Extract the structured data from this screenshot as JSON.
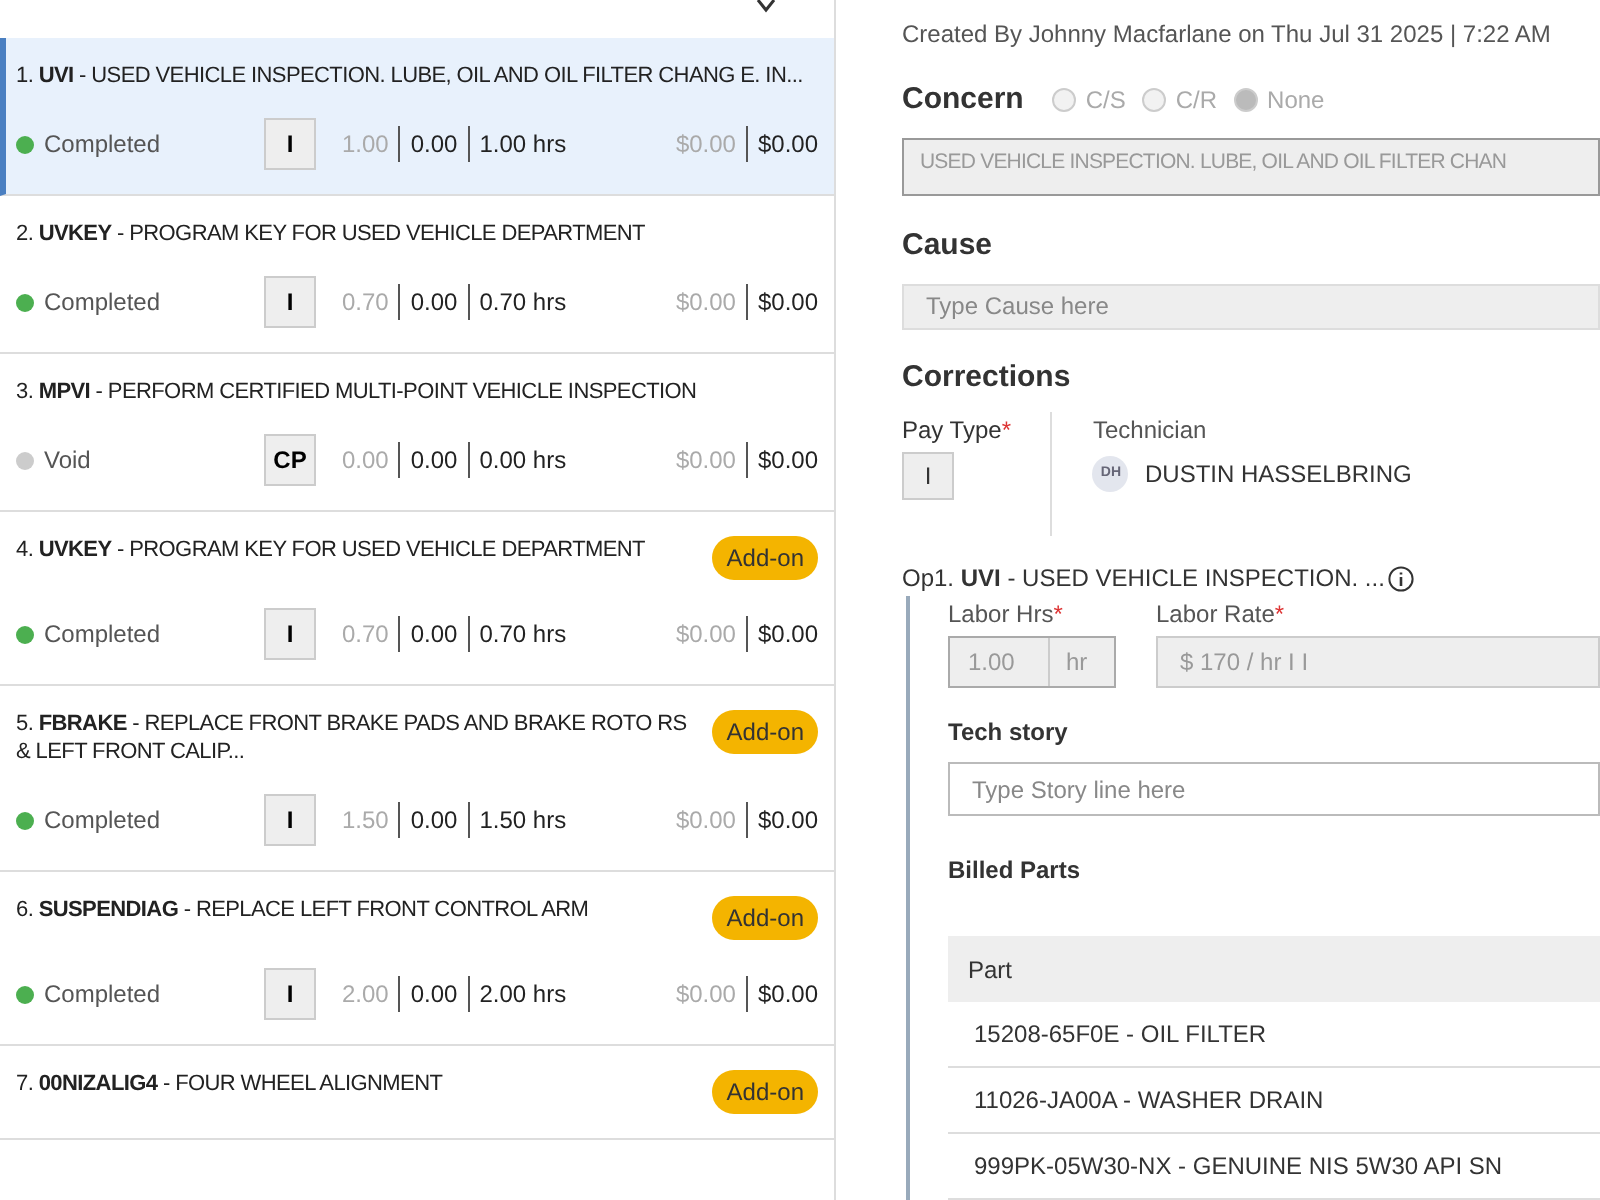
{
  "jobs": [
    {
      "title": "1. **UVI** - USED VEHICLE INSPECTION. LUBE, OIL AND OIL FILTER CHANG E. IN...",
      "selected": true,
      "status": {
        "label": "Completed",
        "color": "#4caf50"
      },
      "pay_type": "I",
      "hours": [
        "1.00",
        "0.00",
        "1.00 hrs"
      ],
      "amounts": [
        "$0.00",
        "$0.00"
      ]
    },
    {
      "title": "2. **UVKEY** - PROGRAM KEY FOR USED VEHICLE DEPARTMENT",
      "selected": false,
      "status": {
        "label": "Completed",
        "color": "#4caf50"
      },
      "pay_type": "I",
      "hours": [
        "0.70",
        "0.00",
        "0.70 hrs"
      ],
      "amounts": [
        "$0.00",
        "$0.00"
      ]
    },
    {
      "title": "3. **MPVI** - PERFORM CERTIFIED MULTI-POINT VEHICLE INSPECTION",
      "selected": false,
      "status": {
        "label": "Void",
        "color": "#cccccc"
      },
      "pay_type": "CP",
      "hours": [
        "0.00",
        "0.00",
        "0.00 hrs"
      ],
      "amounts": [
        "$0.00",
        "$0.00"
      ]
    },
    {
      "title": "4. **UVKEY** - PROGRAM KEY FOR USED VEHICLE DEPARTMENT",
      "badge": "Add-on",
      "selected": false,
      "status": {
        "label": "Completed",
        "color": "#4caf50"
      },
      "pay_type": "I",
      "hours": [
        "0.70",
        "0.00",
        "0.70 hrs"
      ],
      "amounts": [
        "$0.00",
        "$0.00"
      ]
    },
    {
      "title": "5. **FBRAKE** - REPLACE FRONT BRAKE PADS AND BRAKE ROTO RS & LEFT FRONT CALIP...",
      "badge": "Add-on",
      "selected": false,
      "status": {
        "label": "Completed",
        "color": "#4caf50"
      },
      "pay_type": "I",
      "hours": [
        "1.50",
        "0.00",
        "1.50 hrs"
      ],
      "amounts": [
        "$0.00",
        "$0.00"
      ]
    },
    {
      "title": "6. **SUSPENDIAG** - REPLACE LEFT FRONT CONTROL ARM",
      "badge": "Add-on",
      "selected": false,
      "status": {
        "label": "Completed",
        "color": "#4caf50"
      },
      "pay_type": "I",
      "hours": [
        "2.00",
        "0.00",
        "2.00 hrs"
      ],
      "amounts": [
        "$0.00",
        "$0.00"
      ]
    },
    {
      "title": "7. **00NIZALIG4** - FOUR WHEEL ALIGNMENT",
      "badge": "Add-on",
      "selected": false
    }
  ],
  "detail": {
    "created": "Created By Johnny Macfarlane on Thu Jul 31 2025 | 7:22 AM",
    "concern": {
      "heading": "Concern",
      "options": [
        {
          "label": "C/S",
          "selected": false
        },
        {
          "label": "C/R",
          "selected": false
        },
        {
          "label": "None",
          "selected": true
        }
      ],
      "value": "USED VEHICLE INSPECTION. LUBE, OIL AND OIL FILTER CHAN"
    },
    "cause": {
      "heading": "Cause",
      "placeholder": "Type Cause here"
    },
    "corrections": {
      "heading": "Corrections",
      "pay_type_label": "Pay Type",
      "required_mark": "*",
      "pay_type": "I",
      "technician_label": "Technician",
      "technician_initials": "DH",
      "technician": "DUSTIN HASSELBRING"
    },
    "operation": {
      "title": "Op1. **UVI** - USED VEHICLE INSPECTION. ...",
      "labor_hrs_label": "Labor Hrs",
      "labor_hrs": "1.00",
      "labor_hrs_unit": "hr",
      "labor_rate_label": "Labor Rate",
      "labor_rate": "$ 170 / hr I I",
      "tech_story_label": "Tech story",
      "tech_story_placeholder": "Type Story line here",
      "billed_parts_label": "Billed Parts",
      "parts_column": "Part",
      "parts": [
        "15208-65F0E - OIL FILTER",
        "11026-JA00A - WASHER DRAIN",
        "999PK-05W30-NX - GENUINE NIS 5W30 API SN"
      ]
    }
  }
}
